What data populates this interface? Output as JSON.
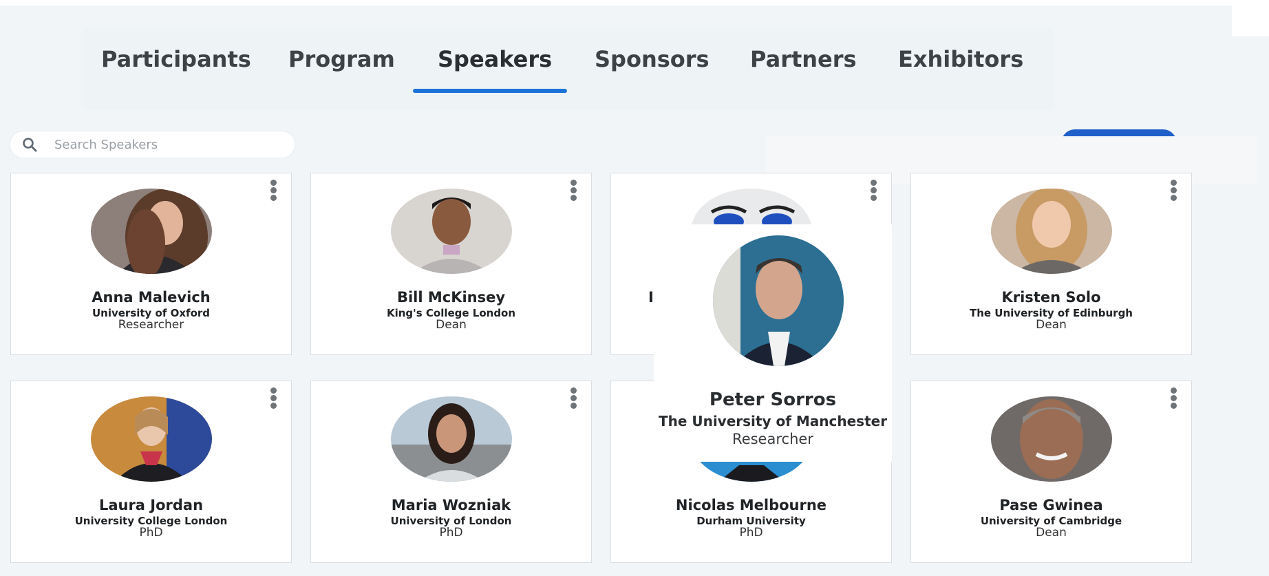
{
  "tabs": [
    {
      "label": "Participants"
    },
    {
      "label": "Program"
    },
    {
      "label": "Speakers",
      "active": true
    },
    {
      "label": "Sponsors"
    },
    {
      "label": "Partners"
    },
    {
      "label": "Exhibitors"
    }
  ],
  "search": {
    "placeholder": "Search Speakers",
    "value": ""
  },
  "colors": {
    "accent": "#1b73d9",
    "button": "#1f5fc9",
    "background": "#f1f5f8"
  },
  "speakers": [
    {
      "name": "Anna Malevich",
      "org": "University of Oxford",
      "role": "Researcher"
    },
    {
      "name": "Bill McKinsey",
      "org": "King's College London",
      "role": "Dean"
    },
    {
      "name": "I",
      "org": "",
      "role": ""
    },
    {
      "name": "Kristen Solo",
      "org": "The University of Edinburgh",
      "role": "Dean"
    },
    {
      "name": "Laura Jordan",
      "org": "University College London",
      "role": "PhD"
    },
    {
      "name": "Maria Wozniak",
      "org": "University of London",
      "role": "PhD"
    },
    {
      "name": "Nicolas Melbourne",
      "org": "Durham University",
      "role": "PhD"
    },
    {
      "name": "Pase Gwinea",
      "org": "University of Cambridge",
      "role": "Dean"
    }
  ],
  "popup": {
    "name": "Peter Sorros",
    "org": "The University of Manchester",
    "role": "Researcher"
  },
  "icons": {
    "search": "search-icon",
    "menu": "kebab-menu-icon"
  }
}
